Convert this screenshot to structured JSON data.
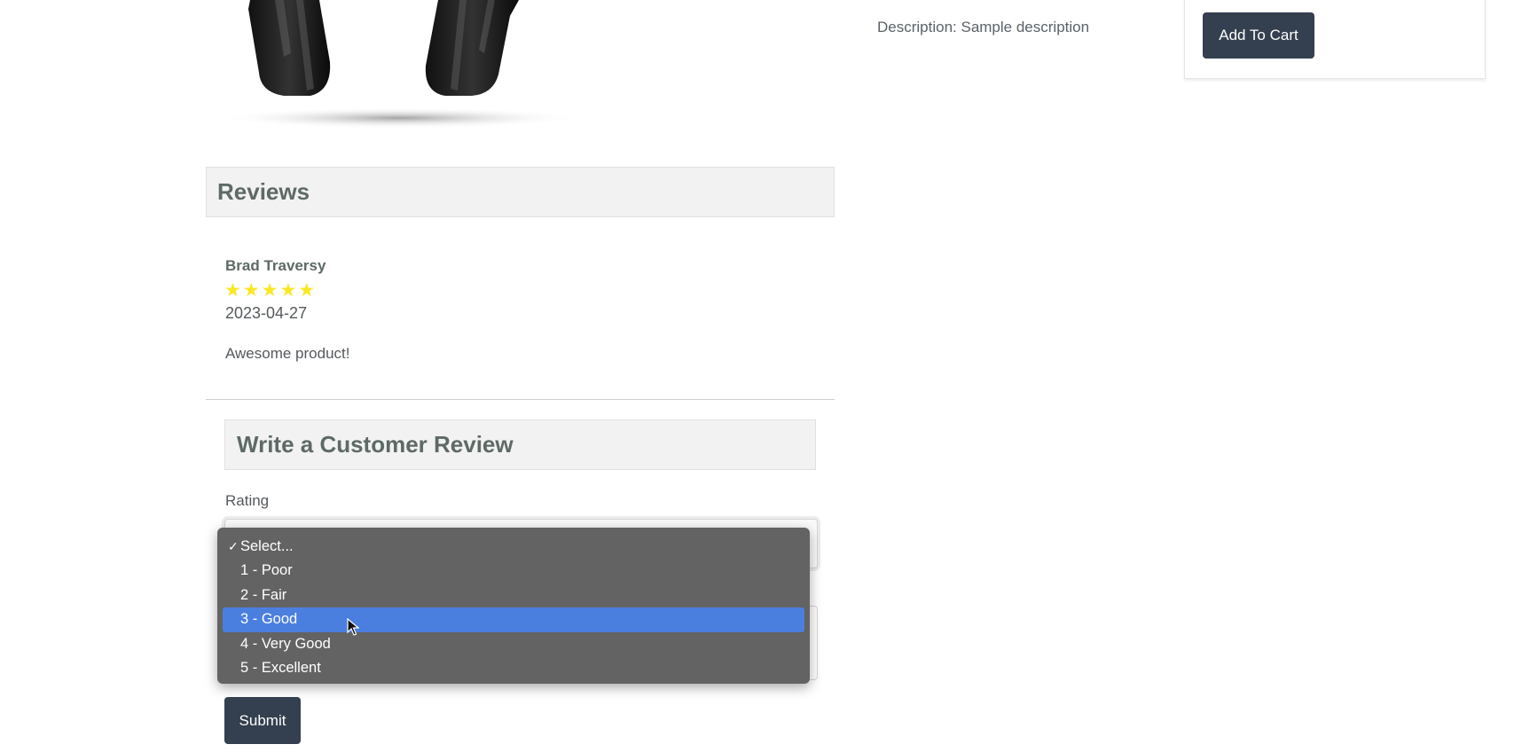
{
  "product": {
    "description_text": "Description: Sample description",
    "add_to_cart_label": "Add To Cart"
  },
  "reviews": {
    "heading": "Reviews",
    "items": [
      {
        "name": "Brad Traversy",
        "rating": 5,
        "date": "2023-04-27",
        "comment": "Awesome product!"
      }
    ]
  },
  "review_form": {
    "heading": "Write a Customer Review",
    "rating_label": "Rating",
    "rating_options": [
      {
        "label": "Select...",
        "checked": true
      },
      {
        "label": "1 - Poor"
      },
      {
        "label": "2 - Fair"
      },
      {
        "label": "3 - Good",
        "highlighted": true
      },
      {
        "label": "4 - Very Good"
      },
      {
        "label": "5 - Excellent"
      }
    ],
    "check_glyph": "✓",
    "submit_label": "Submit"
  },
  "colors": {
    "button": "#343f4f",
    "star": "#f8e825",
    "option_highlight": "#4a7fe0",
    "dropdown_bg": "#636363"
  }
}
